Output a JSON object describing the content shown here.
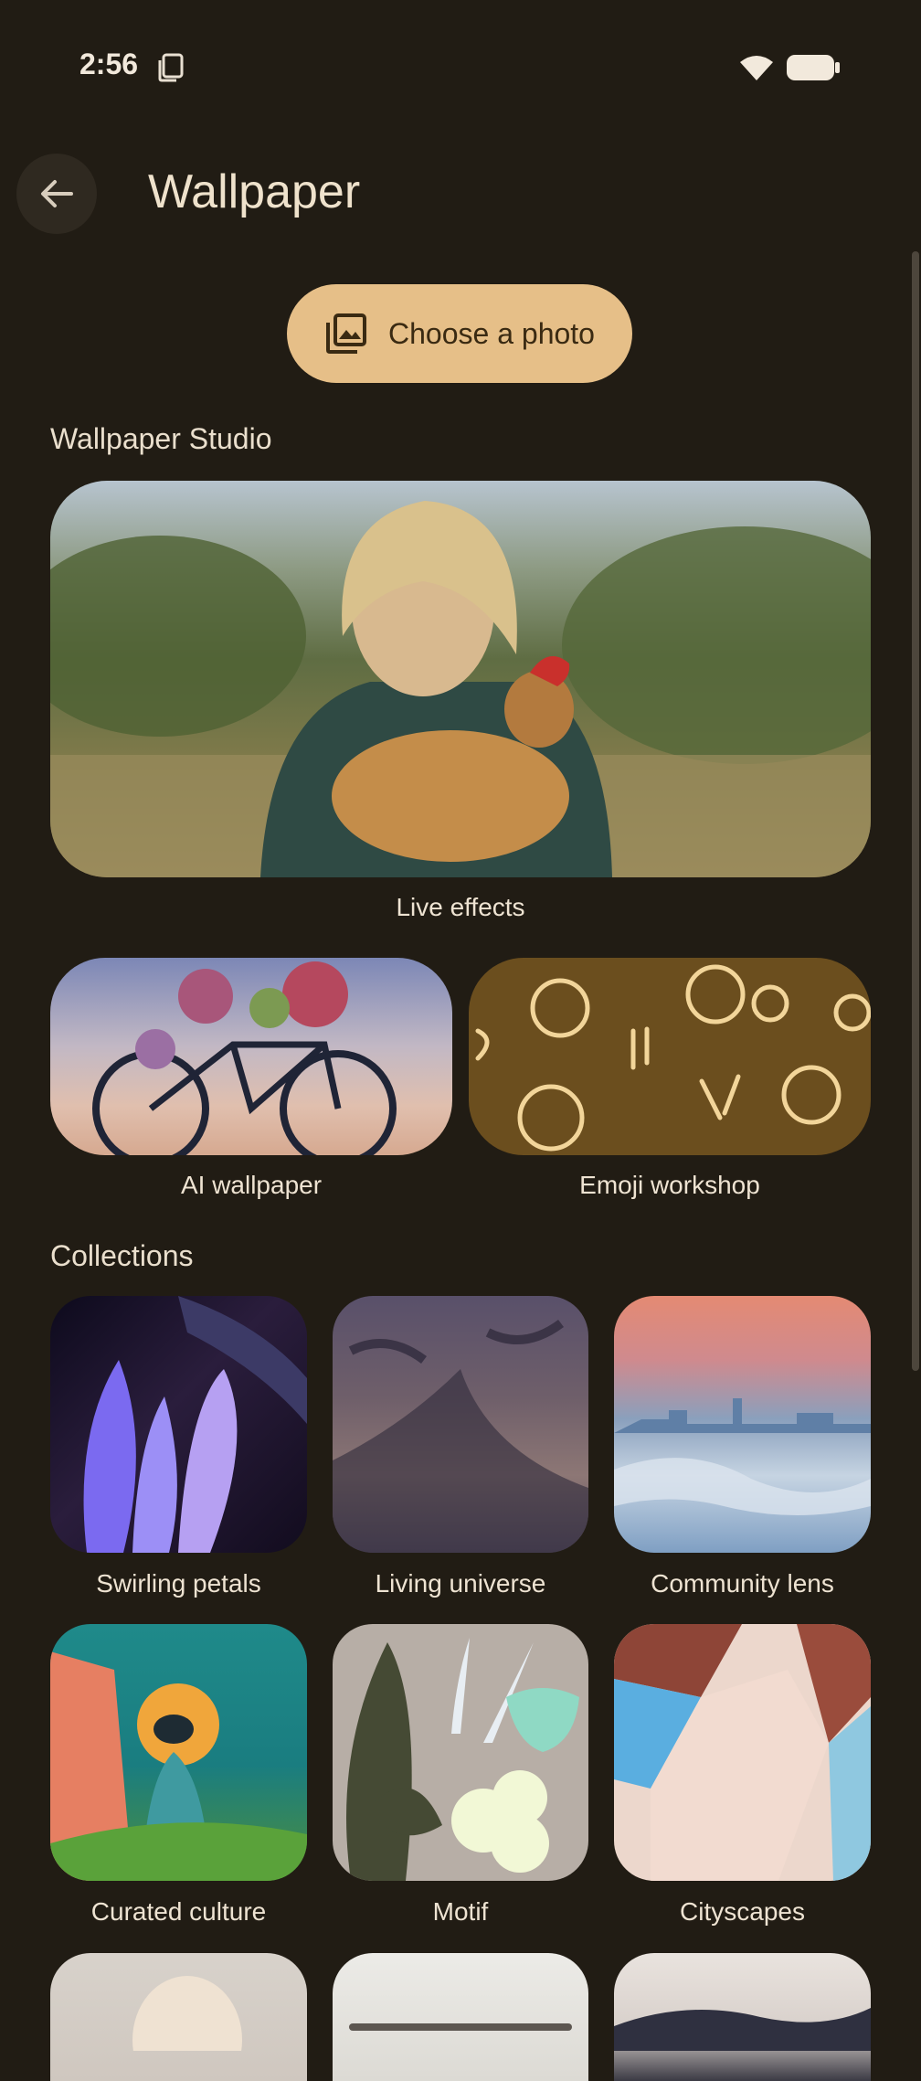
{
  "status_bar": {
    "time": "2:56"
  },
  "header": {
    "title": "Wallpaper"
  },
  "actions": {
    "choose_photo": "Choose a photo"
  },
  "studio": {
    "heading": "Wallpaper Studio",
    "live_effects": "Live effects",
    "ai_wallpaper": "AI wallpaper",
    "emoji_workshop": "Emoji workshop"
  },
  "collections": {
    "heading": "Collections",
    "items": [
      {
        "label": "Swirling petals"
      },
      {
        "label": "Living universe"
      },
      {
        "label": "Community lens"
      },
      {
        "label": "Curated culture"
      },
      {
        "label": "Motif"
      },
      {
        "label": "Cityscapes"
      }
    ]
  },
  "colors": {
    "background": "#211c14",
    "accent_button": "#e6bf88",
    "text": "#ede1cf"
  }
}
